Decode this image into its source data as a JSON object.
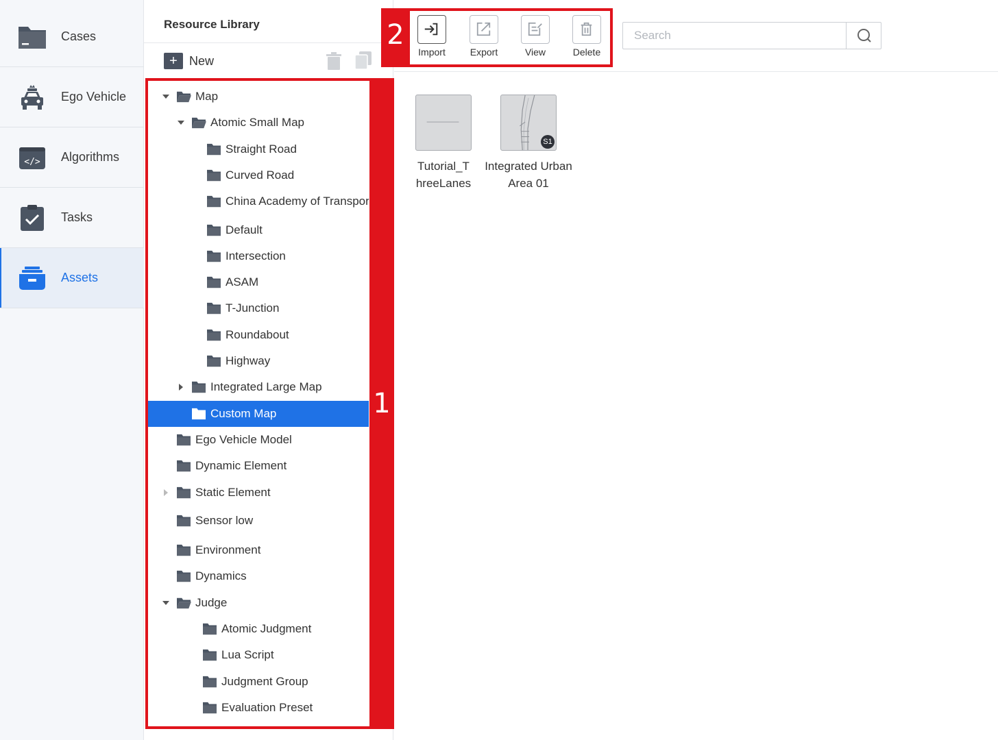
{
  "nav": {
    "items": [
      {
        "label": "Cases",
        "icon": "folder-icon"
      },
      {
        "label": "Ego Vehicle",
        "icon": "car-icon"
      },
      {
        "label": "Algorithms",
        "icon": "code-icon"
      },
      {
        "label": "Tasks",
        "icon": "checklist-icon"
      },
      {
        "label": "Assets",
        "icon": "toolbox-icon",
        "active": true
      }
    ]
  },
  "library": {
    "title": "Resource Library",
    "new_label": "New",
    "tree": [
      {
        "label": "Map",
        "depth": 0,
        "expanded": true,
        "has_children": true
      },
      {
        "label": "Atomic Small Map",
        "depth": 1,
        "expanded": true,
        "has_children": true
      },
      {
        "label": "Straight Road",
        "depth": 2
      },
      {
        "label": "Curved Road",
        "depth": 2
      },
      {
        "label": "China Academy of Transportation",
        "depth": 2
      },
      {
        "label": "Default",
        "depth": 2
      },
      {
        "label": "Intersection",
        "depth": 2
      },
      {
        "label": "ASAM",
        "depth": 2
      },
      {
        "label": "T-Junction",
        "depth": 2
      },
      {
        "label": "Roundabout",
        "depth": 2
      },
      {
        "label": "Highway",
        "depth": 2
      },
      {
        "label": "Integrated Large Map",
        "depth": 1,
        "expanded": false,
        "has_children": true
      },
      {
        "label": "Custom Map",
        "depth": 1,
        "selected": true
      },
      {
        "label": "Ego Vehicle Model",
        "depth": 0
      },
      {
        "label": "Dynamic Element",
        "depth": 0
      },
      {
        "label": "Static Element",
        "depth": 0,
        "expanded": false,
        "has_children": true
      },
      {
        "label": "Sensor low",
        "depth": 0
      },
      {
        "label": "Environment",
        "depth": 0
      },
      {
        "label": "Dynamics",
        "depth": 0
      },
      {
        "label": "Judge",
        "depth": 0,
        "expanded": true,
        "has_children": true
      },
      {
        "label": "Atomic Judgment",
        "depth": 1
      },
      {
        "label": "Lua Script",
        "depth": 1
      },
      {
        "label": "Judgment Group",
        "depth": 1
      },
      {
        "label": "Evaluation Preset",
        "depth": 1
      }
    ]
  },
  "toolbar": {
    "import_label": "Import",
    "export_label": "Export",
    "view_label": "View",
    "delete_label": "Delete"
  },
  "search": {
    "placeholder": "Search",
    "value": ""
  },
  "assets": [
    {
      "name": "Tutorial_ThreeLanes",
      "name_lines": [
        "Tutorial_T",
        "hreeLanes"
      ]
    },
    {
      "name": "Integrated Urban Area 01",
      "name_lines": [
        "Integrated Urban",
        "Area 01"
      ],
      "badge": "S1"
    }
  ],
  "annotations": {
    "tree_label": "1",
    "toolbar_label": "2"
  },
  "colors": {
    "accent": "#1f72e6",
    "annotation": "#e0141c",
    "selected_bg": "#1f72e6"
  }
}
